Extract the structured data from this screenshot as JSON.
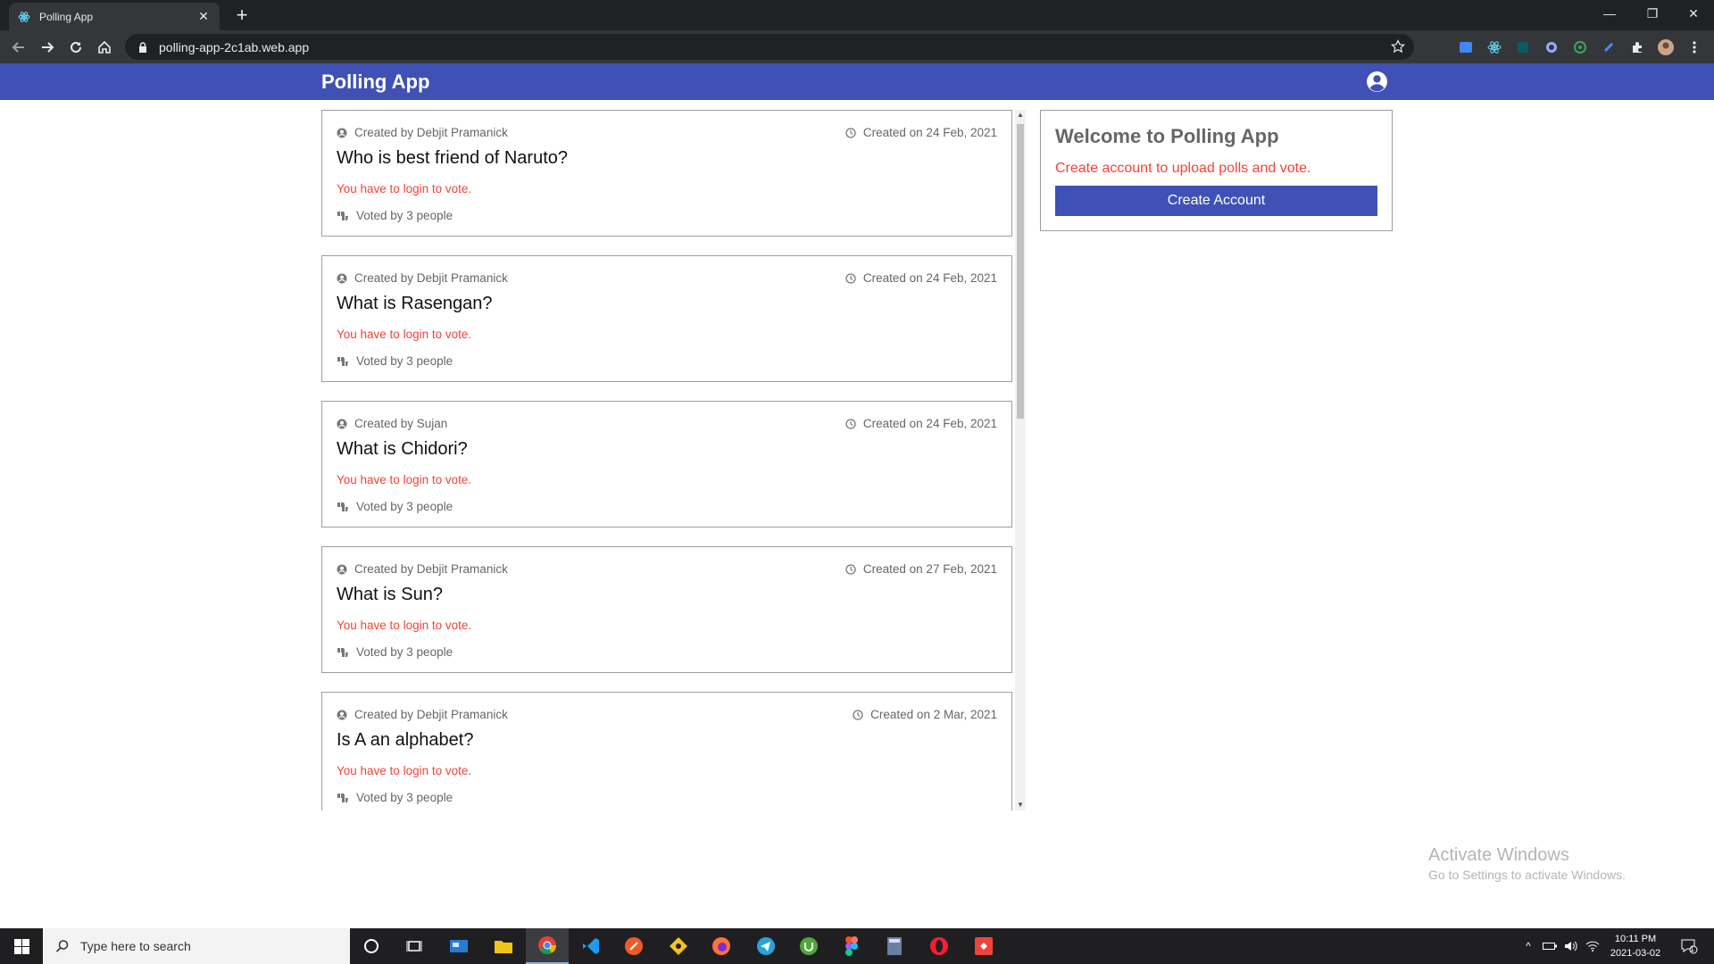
{
  "browser": {
    "tab_title": "Polling App",
    "url": "polling-app-2c1ab.web.app"
  },
  "app": {
    "brand": "Polling App",
    "accent_color": "#3f51b5",
    "error_color": "#f44336"
  },
  "polls": [
    {
      "creator": "Created by Debjit Pramanick",
      "date": "Created on 24 Feb, 2021",
      "question": "Who is best friend of Naruto?",
      "login_notice": "You have to login to vote.",
      "votes": "Voted by 3 people"
    },
    {
      "creator": "Created by Debjit Pramanick",
      "date": "Created on 24 Feb, 2021",
      "question": "What is Rasengan?",
      "login_notice": "You have to login to vote.",
      "votes": "Voted by 3 people"
    },
    {
      "creator": "Created by Sujan",
      "date": "Created on 24 Feb, 2021",
      "question": "What is Chidori?",
      "login_notice": "You have to login to vote.",
      "votes": "Voted by 3 people"
    },
    {
      "creator": "Created by Debjit Pramanick",
      "date": "Created on 27 Feb, 2021",
      "question": "What is Sun?",
      "login_notice": "You have to login to vote.",
      "votes": "Voted by 3 people"
    },
    {
      "creator": "Created by Debjit Pramanick",
      "date": "Created on 2 Mar, 2021",
      "question": "Is A an alphabet?",
      "login_notice": "You have to login to vote.",
      "votes": "Voted by 3 people"
    }
  ],
  "welcome": {
    "title": "Welcome to Polling App",
    "description": "Create account to upload polls and vote.",
    "button": "Create Account"
  },
  "watermark": {
    "line1": "Activate Windows",
    "line2": "Go to Settings to activate Windows."
  },
  "taskbar": {
    "search_placeholder": "Type here to search",
    "time": "10:11 PM",
    "date": "2021-03-02",
    "notification_count": "1"
  }
}
